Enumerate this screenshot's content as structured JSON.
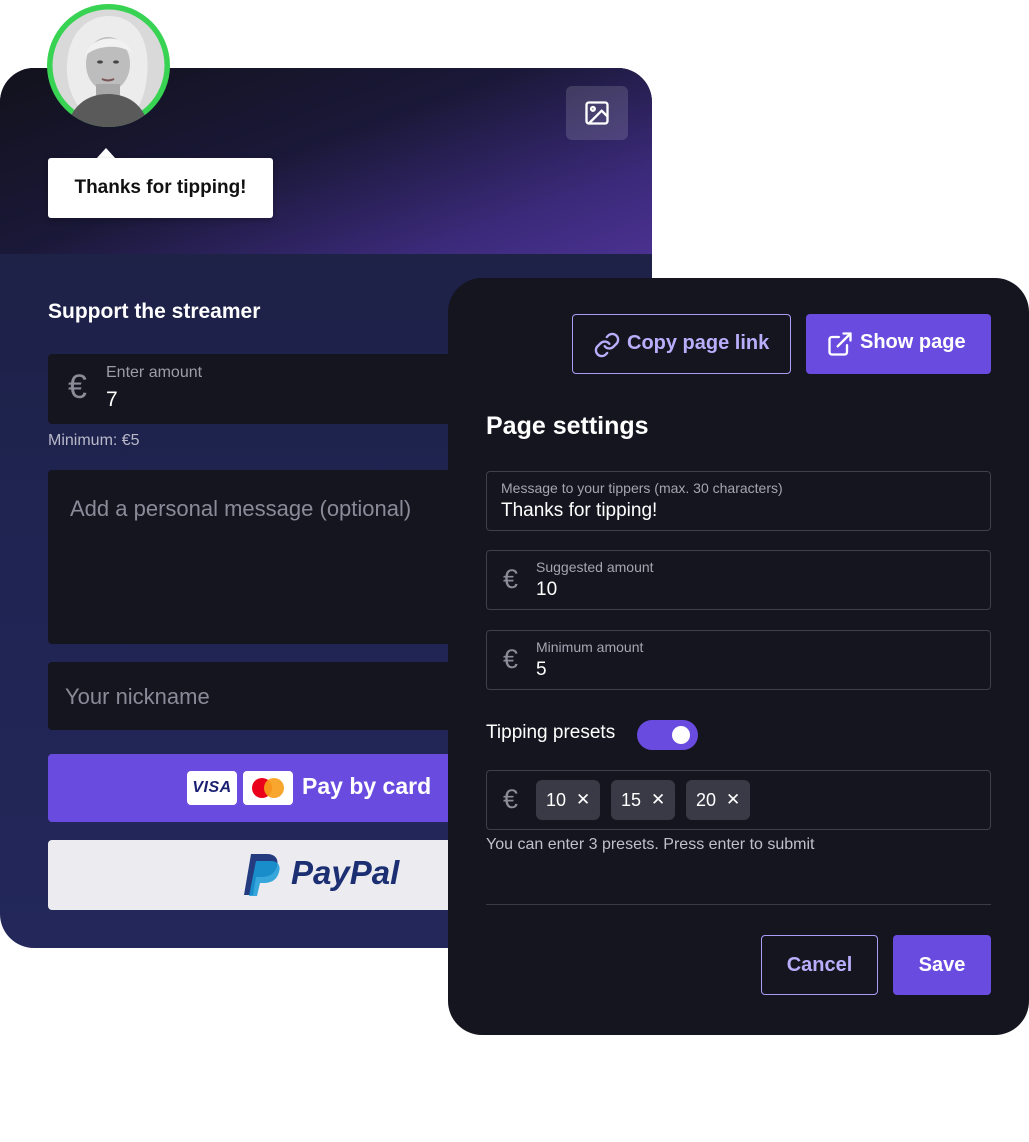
{
  "tip_page": {
    "bubble_message": "Thanks for tipping!",
    "support_title": "Support the streamer",
    "amount": {
      "currency_symbol": "€",
      "label": "Enter amount",
      "value": "7"
    },
    "minimum_hint": "Minimum: €5",
    "message_placeholder": "Add a personal message (optional)",
    "nickname_placeholder": "Your nickname",
    "pay_by_card_label": "Pay by card",
    "visa_text": "VISA",
    "paypal_text": "PayPal",
    "colors": {
      "accent": "#6a4be0",
      "avatar_ring": "#39d353"
    }
  },
  "settings": {
    "copy_link_label": "Copy page link",
    "show_page_label": "Show page",
    "title": "Page settings",
    "message_field": {
      "label": "Message to your tippers (max. 30 characters)",
      "value": "Thanks for tipping!"
    },
    "suggested_field": {
      "currency_symbol": "€",
      "label": "Suggested amount",
      "value": "10"
    },
    "minimum_field": {
      "currency_symbol": "€",
      "label": "Minimum amount",
      "value": "5"
    },
    "presets_label": "Tipping presets",
    "presets_enabled": true,
    "presets_currency_symbol": "€",
    "presets": [
      "10",
      "15",
      "20"
    ],
    "remove_glyph": "✕",
    "presets_hint": "You can enter 3 presets. Press enter to submit",
    "cancel_label": "Cancel",
    "save_label": "Save"
  }
}
